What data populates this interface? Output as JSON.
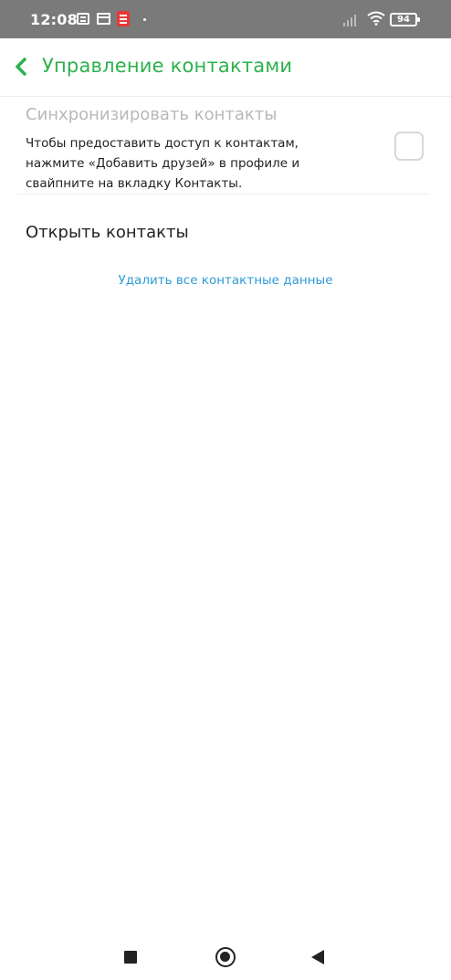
{
  "status_bar": {
    "time": "12:08",
    "battery": "94",
    "icons": [
      "message-icon",
      "window-icon",
      "document-icon",
      "dot-icon",
      "signal-icon",
      "wifi-icon",
      "battery-icon"
    ]
  },
  "header": {
    "back_icon": "chevron-left-icon",
    "title": "Управление контактами"
  },
  "sync": {
    "title": "Синхронизировать контакты",
    "description": "Чтобы предоставить доступ к контактам, нажмите «Добавить друзей» в профиле и свайпните на вкладку Контакты.",
    "checked": false
  },
  "open_contacts": "Открыть контакты",
  "delete_link": "Удалить все контактные данные",
  "colors": {
    "accent": "#2bb24c",
    "link": "#2e9bd6",
    "status_bar": "#7a7a7a",
    "disabled_text": "#b8b8b8"
  },
  "navbar": {
    "icons": [
      "recent-apps-icon",
      "home-icon",
      "back-icon"
    ]
  }
}
